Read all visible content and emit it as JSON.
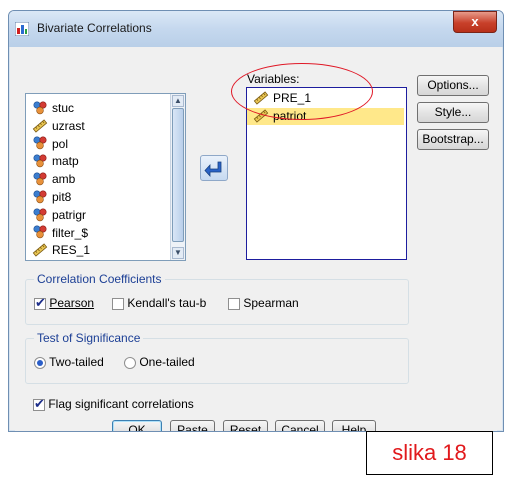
{
  "window": {
    "title": "Bivariate Correlations",
    "close_glyph": "x"
  },
  "source_list": {
    "items": [
      {
        "label": "stuc",
        "icon": "nominal-variable-icon"
      },
      {
        "label": "uzrast",
        "icon": "scale-variable-icon"
      },
      {
        "label": "pol",
        "icon": "nominal-variable-icon"
      },
      {
        "label": "matp",
        "icon": "nominal-variable-icon"
      },
      {
        "label": "amb",
        "icon": "nominal-variable-icon"
      },
      {
        "label": "pit8",
        "icon": "nominal-variable-icon"
      },
      {
        "label": "patrigr",
        "icon": "nominal-variable-icon"
      },
      {
        "label": "filter_$",
        "icon": "nominal-variable-icon"
      },
      {
        "label": "RES_1",
        "icon": "scale-variable-icon"
      }
    ]
  },
  "variables": {
    "label": "Variables:",
    "items": [
      {
        "label": "PRE_1",
        "icon": "scale-variable-icon",
        "selected": false
      },
      {
        "label": "patriot",
        "icon": "scale-variable-icon",
        "selected": true
      }
    ]
  },
  "side_buttons": {
    "options": "Options...",
    "style": "Style...",
    "bootstrap": "Bootstrap..."
  },
  "correlation": {
    "title": "Correlation Coefficients",
    "pearson": "Pearson",
    "pearson_checked": true,
    "kendall": "Kendall's tau-b",
    "kendall_checked": false,
    "spearman": "Spearman",
    "spearman_checked": false
  },
  "significance": {
    "title": "Test of Significance",
    "two_tailed": "Two-tailed",
    "one_tailed": "One-tailed",
    "selected": "Two-tailed"
  },
  "flag": {
    "label": "Flag significant correlations",
    "checked": true
  },
  "bottom_buttons": {
    "ok": "OK",
    "paste": "Paste",
    "reset": "Reset",
    "cancel": "Cancel",
    "help": "Help"
  },
  "overlay_label": "slika 18",
  "colors": {
    "highlight": "#ffe88a",
    "annotation": "#e01a28",
    "group_title": "#1c3f95"
  }
}
